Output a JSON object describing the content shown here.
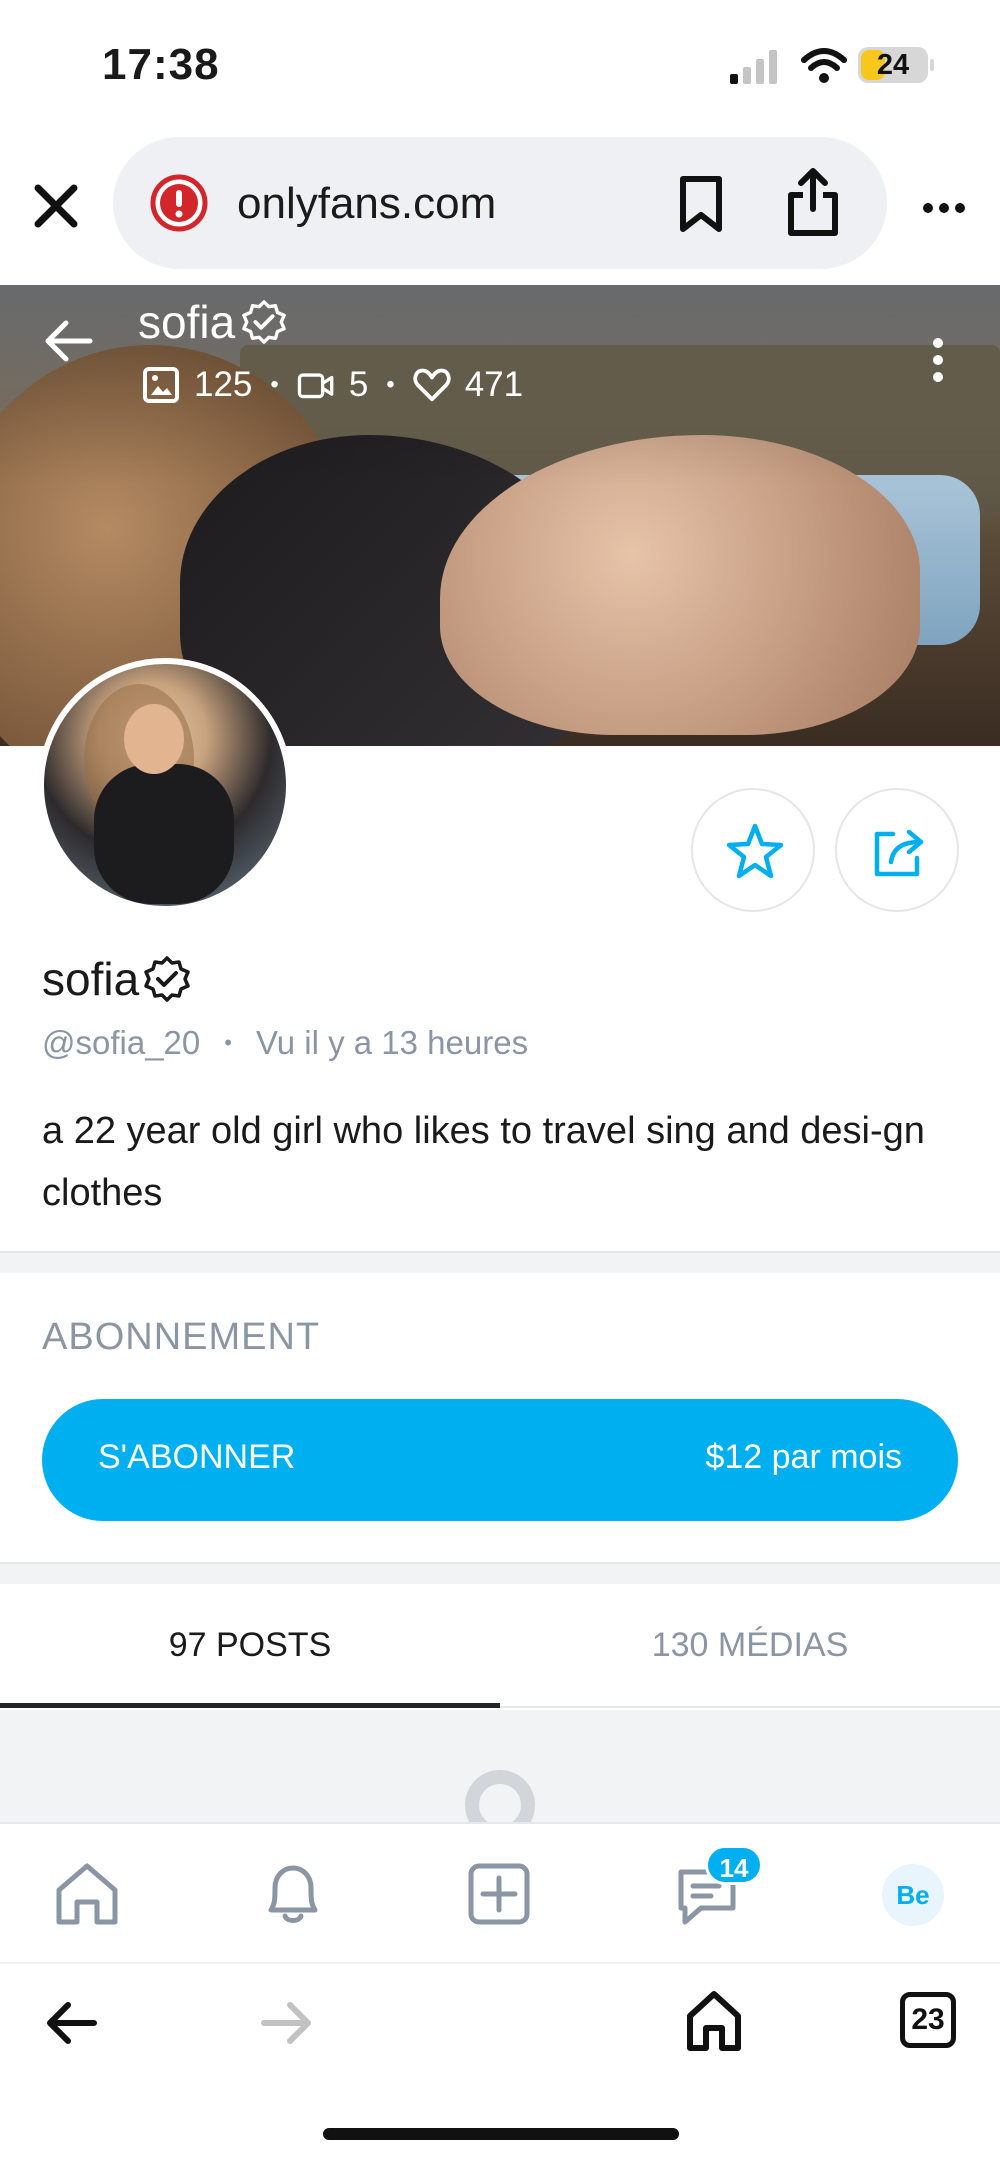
{
  "status_bar": {
    "time": "17:38",
    "battery_level": "24",
    "icons": [
      "cellular-signal-icon",
      "wifi-icon",
      "battery-icon"
    ]
  },
  "browser": {
    "url": "onlyfans.com",
    "icons": [
      "close-icon",
      "warning-icon",
      "bookmark-icon",
      "share-icon",
      "more-icon"
    ]
  },
  "cover": {
    "name": "sofia",
    "stats": {
      "photos": "125",
      "videos": "5",
      "likes": "471"
    },
    "icons": [
      "back-arrow-icon",
      "verified-icon",
      "image-icon",
      "video-icon",
      "heart-icon",
      "vertical-dots-icon"
    ]
  },
  "profile": {
    "name": "sofia",
    "handle": "@sofia_20",
    "last_seen": "Vu  il y a 13 heures",
    "bio": "a 22 year old girl who likes to travel sing and desi-gn clothes",
    "icons": [
      "star-icon",
      "share-out-icon",
      "verified-icon"
    ]
  },
  "subscription": {
    "heading": "ABONNEMENT",
    "button_label": "S'ABONNER",
    "price": "$12 par mois"
  },
  "tabs": {
    "posts": "97 POSTS",
    "media": "130 MÉDIAS",
    "active": "posts"
  },
  "app_nav": {
    "messages_badge": "14",
    "avatar_initials": "Be",
    "icons": [
      "home-icon",
      "bell-icon",
      "add-post-icon",
      "chat-icon"
    ]
  },
  "browser_nav": {
    "tab_count": "23",
    "icons": [
      "back-icon",
      "forward-icon",
      "home-icon"
    ]
  },
  "colors": {
    "accent": "#00aff0",
    "muted_text": "#8a96a3",
    "divider": "#f2f3f5"
  }
}
